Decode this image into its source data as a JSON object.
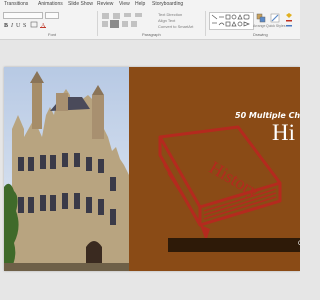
{
  "tabs": [
    "Transitions",
    "Animations",
    "Slide Show",
    "Review",
    "View",
    "Help",
    "Storyboarding"
  ],
  "ribbon": {
    "groups": [
      "Font",
      "Paragraph",
      "Drawing"
    ],
    "text_direction": "Text Direction",
    "align_text": "Align Text",
    "convert_smartart": "Convert to SmartArt",
    "arrange": "Arrange",
    "quick_styles": "Quick Styles"
  },
  "slide": {
    "subtitle": "50 Multiple Choi",
    "title": "Hi",
    "book_label": "History",
    "bar_text": "Q"
  },
  "colors": {
    "slide_background": "#8a4b16",
    "book_red": "#b42a1e",
    "bar": "#2e1a08",
    "ribbon": "#f3f3f3"
  }
}
